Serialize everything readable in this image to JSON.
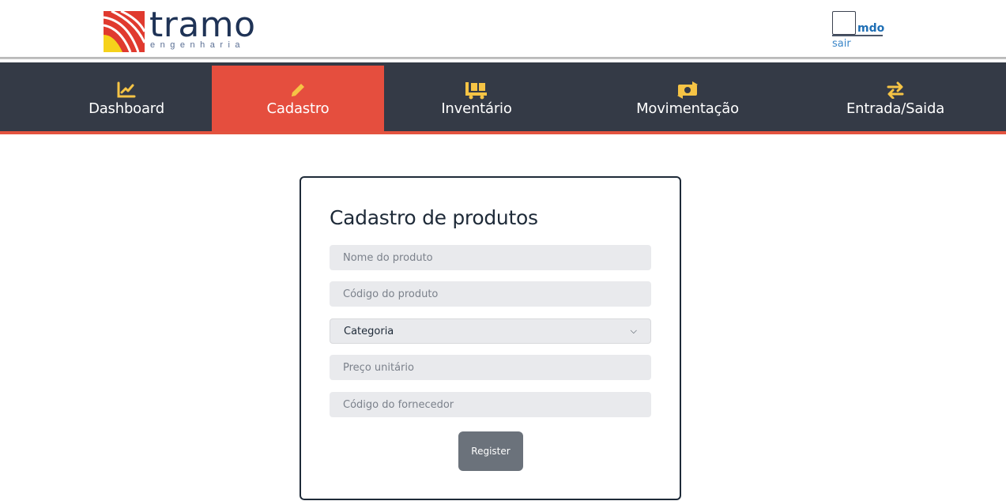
{
  "brand": {
    "name": "tramo",
    "tagline": "engenharia",
    "colors": {
      "red": "#e03a2f",
      "yellow": "#f6d21b",
      "navy": "#1f3356"
    }
  },
  "user": {
    "name": "mdo",
    "logout_label": "sair"
  },
  "nav": {
    "items": [
      {
        "label": "Dashboard",
        "icon": "chart-line-icon"
      },
      {
        "label": "Cadastro",
        "icon": "pencil-icon",
        "active": true
      },
      {
        "label": "Inventário",
        "icon": "pallet-dolly-icon"
      },
      {
        "label": "Movimentação",
        "icon": "money-exchange-icon"
      },
      {
        "label": "Entrada/Saida",
        "icon": "exchange-arrows-icon"
      }
    ],
    "colors": {
      "bar": "#343a46",
      "active": "#e54e3e",
      "icon": "#f6c445"
    }
  },
  "form": {
    "title": "Cadastro de produtos",
    "fields": {
      "product_name": {
        "placeholder": "Nome do produto",
        "value": ""
      },
      "product_code": {
        "placeholder": "Código do produto",
        "value": ""
      },
      "category": {
        "selected": "Categoria"
      },
      "unit_price": {
        "placeholder": "Preço unitário",
        "value": ""
      },
      "supplier_code": {
        "placeholder": "Código do fornecedor",
        "value": ""
      }
    },
    "submit_label": "Register"
  }
}
